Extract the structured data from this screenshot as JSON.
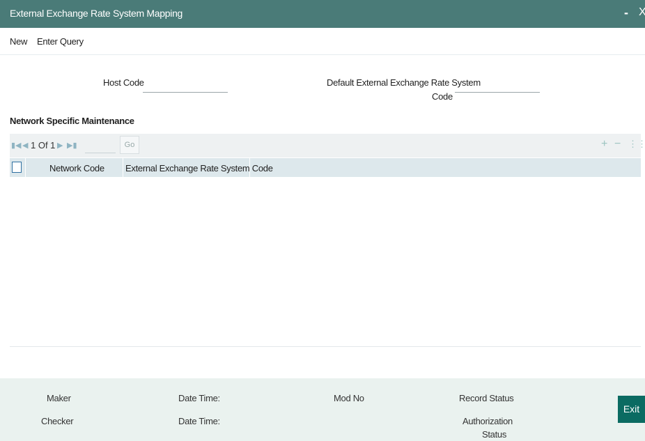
{
  "window": {
    "title": "External Exchange Rate System Mapping",
    "minimize_glyph": "-",
    "close_glyph": "X"
  },
  "menu": {
    "new_label": "New",
    "enter_query_label": "Enter Query"
  },
  "form": {
    "host_code_label": "Host Code",
    "host_code_value": "",
    "default_ext_rate_label_line1": "Default External Exchange Rate System",
    "default_ext_rate_label_line2": "Code",
    "default_ext_rate_value": ""
  },
  "section": {
    "title": "Network Specific Maintenance"
  },
  "pager": {
    "info": "1 Of 1",
    "go_label": "Go",
    "page_input_value": "",
    "tools": {
      "add_glyph": "+",
      "remove_glyph": "−",
      "columns_glyph": "⋮⋮"
    }
  },
  "grid": {
    "columns": [
      "Network Code",
      "External Exchange Rate System Code"
    ],
    "rows": []
  },
  "footer": {
    "maker_label": "Maker",
    "checker_label": "Checker",
    "date_time_label_1": "Date Time:",
    "date_time_label_2": "Date Time:",
    "mod_no_label": "Mod No",
    "record_status_label": "Record Status",
    "authorization_status_line1": "Authorization",
    "authorization_status_line2": "Status",
    "exit_label": "Exit"
  },
  "colors": {
    "titlebar": "#4a7b78",
    "pager_bg": "#eef1f2",
    "grid_header_bg": "#dde8ec",
    "footer_bg": "#eaf2ef",
    "exit_button": "#0b6b62",
    "checkbox_border": "#2e6fa0"
  },
  "icons": {
    "first_page": "first-page-icon",
    "prev_page": "prev-page-icon",
    "next_page": "next-page-icon",
    "last_page": "last-page-icon",
    "add_row": "plus-icon",
    "remove_row": "minus-icon",
    "columns": "grid-dots-icon"
  }
}
